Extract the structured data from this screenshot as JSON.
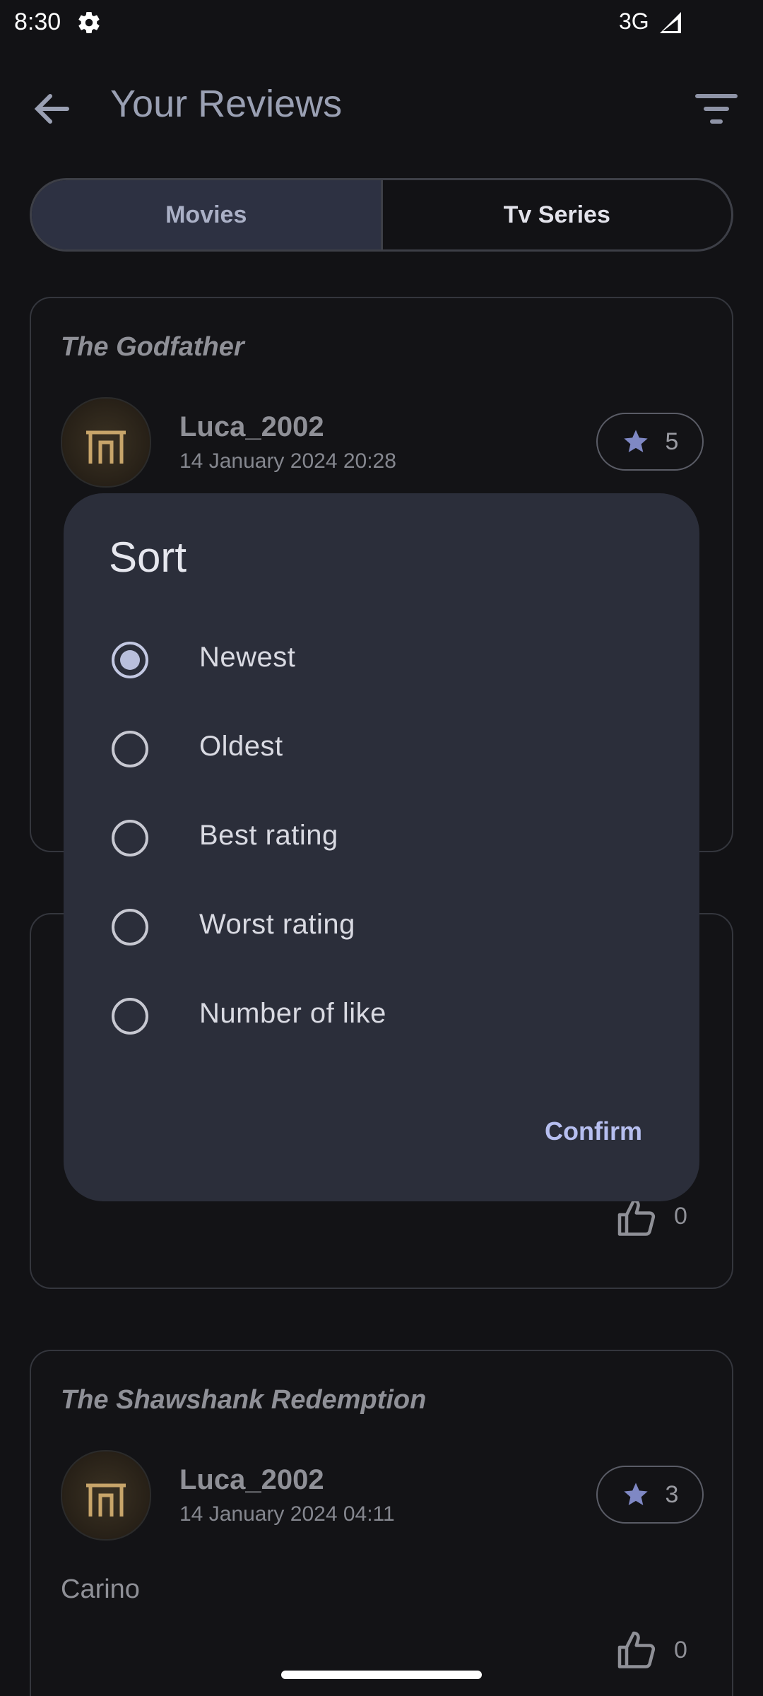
{
  "status_bar": {
    "time": "8:30",
    "network": "3G"
  },
  "app_bar": {
    "title": "Your Reviews"
  },
  "tabs": [
    {
      "label": "Movies",
      "active": true
    },
    {
      "label": "Tv Series",
      "active": false
    }
  ],
  "reviews": [
    {
      "movie": "The Godfather",
      "user": "Luca_2002",
      "date": "14 January 2024 20:28",
      "rating": "5"
    },
    {
      "likes": "0"
    },
    {
      "movie": "The Shawshank Redemption",
      "user": "Luca_2002",
      "date": "14 January 2024 04:11",
      "rating": "3",
      "text": "Carino",
      "likes": "0"
    }
  ],
  "sort_dialog": {
    "title": "Sort",
    "options": [
      {
        "label": "Newest",
        "selected": true
      },
      {
        "label": "Oldest",
        "selected": false
      },
      {
        "label": "Best rating",
        "selected": false
      },
      {
        "label": "Worst rating",
        "selected": false
      },
      {
        "label": "Number of like",
        "selected": false
      }
    ],
    "confirm_label": "Confirm"
  },
  "colors": {
    "background": "#121215",
    "dialog": "#2b2e3a",
    "accent": "#b7bff0",
    "tab_active": "#2d3142",
    "star": "#7f88c4"
  },
  "icons": {
    "back": "arrow-left-icon",
    "filter": "filter-list-icon",
    "star": "star-icon",
    "like": "thumb-up-icon",
    "settings": "gear-icon",
    "signal": "signal-icon"
  }
}
